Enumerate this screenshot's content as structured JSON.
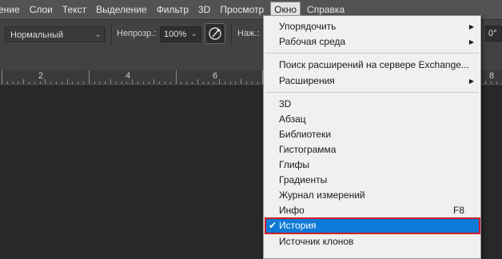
{
  "menubar": {
    "items": [
      "ение",
      "Слои",
      "Текст",
      "Выделение",
      "Фильтр",
      "3D",
      "Просмотр",
      "Окно",
      "Справка"
    ],
    "active_index": 7
  },
  "options_bar": {
    "blend_mode": "Нормальный",
    "opacity_label": "Непрозр.:",
    "opacity_value": "100%",
    "pressure_label": "Наж.:",
    "angle_value": "0°"
  },
  "ruler": {
    "numbers": [
      "2",
      "4",
      "6",
      "8"
    ]
  },
  "window_menu": {
    "items": [
      {
        "label": "Упорядочить",
        "submenu": true
      },
      {
        "label": "Рабочая среда",
        "submenu": true
      },
      {
        "label": "Поиск расширений на сервере Exchange..."
      },
      {
        "label": "Расширения",
        "submenu": true
      },
      {
        "label": "3D"
      },
      {
        "label": "Абзац"
      },
      {
        "label": "Библиотеки"
      },
      {
        "label": "Гистограмма"
      },
      {
        "label": "Глифы"
      },
      {
        "label": "Градиенты"
      },
      {
        "label": "Журнал измерений"
      },
      {
        "label": "Инфо",
        "shortcut": "F8"
      },
      {
        "label": "История",
        "checked": true,
        "highlighted": true
      },
      {
        "label": "Источник клонов"
      }
    ],
    "check_glyph": "✔",
    "submenu_glyph": "▶"
  },
  "colors": {
    "highlight": "#0c7ad6",
    "highlight_outline": "#d21c2b"
  }
}
